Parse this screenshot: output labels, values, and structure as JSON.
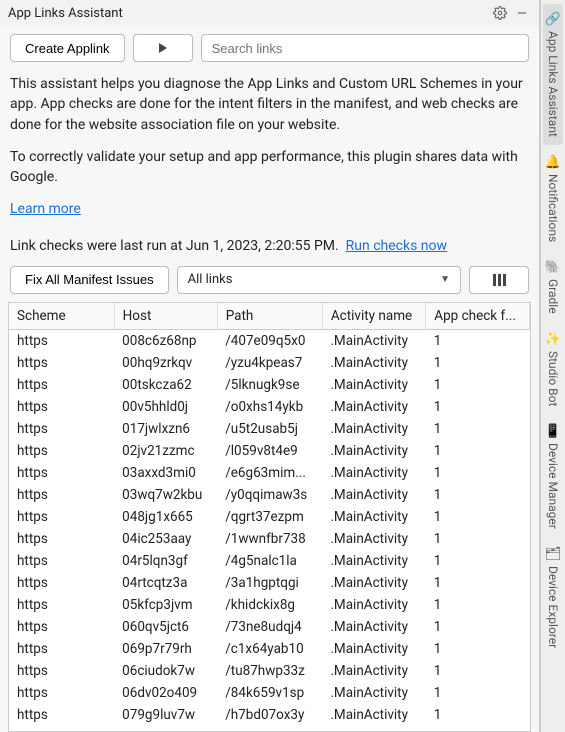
{
  "panel": {
    "title": "App Links Assistant"
  },
  "toolbar": {
    "create_label": "Create Applink",
    "search_placeholder": "Search links"
  },
  "description": {
    "p1": "This assistant helps you diagnose the App Links and Custom URL Schemes in your app. App checks are done for the intent filters in the manifest, and web checks are done for the website association file on your website.",
    "p2": "To correctly validate your setup and app performance, this plugin shares data with Google.",
    "learn_more": "Learn more"
  },
  "status": {
    "last_run_prefix": "Link checks were last run at ",
    "last_run_time": "Jun 1, 2023, 2:20:55 PM.",
    "run_now": "Run checks now"
  },
  "controls": {
    "fix_label": "Fix All Manifest Issues",
    "filter_label": "All links"
  },
  "table": {
    "headers": {
      "scheme": "Scheme",
      "host": "Host",
      "path": "Path",
      "activity": "Activity name",
      "check": "App check f..."
    },
    "rows": [
      {
        "scheme": "https",
        "host": "008c6z68np",
        "path": "/407e09q5x0",
        "activity": ".MainActivity",
        "check": "1"
      },
      {
        "scheme": "https",
        "host": "00hq9zrkqv",
        "path": "/yzu4kpeas7",
        "activity": ".MainActivity",
        "check": "1"
      },
      {
        "scheme": "https",
        "host": "00tskcza62",
        "path": "/5lknugk9se",
        "activity": ".MainActivity",
        "check": "1"
      },
      {
        "scheme": "https",
        "host": "00v5hhld0j",
        "path": "/o0xhs14ykb",
        "activity": ".MainActivity",
        "check": "1"
      },
      {
        "scheme": "https",
        "host": "017jwlxzn6",
        "path": "/u5t2usab5j",
        "activity": ".MainActivity",
        "check": "1"
      },
      {
        "scheme": "https",
        "host": "02jv21zzmc",
        "path": "/l059v8t4e9",
        "activity": ".MainActivity",
        "check": "1"
      },
      {
        "scheme": "https",
        "host": "03axxd3mi0",
        "path": "/e6g63mim...",
        "activity": ".MainActivity",
        "check": "1"
      },
      {
        "scheme": "https",
        "host": "03wq7w2kbu",
        "path": "/y0qqimaw3s",
        "activity": ".MainActivity",
        "check": "1"
      },
      {
        "scheme": "https",
        "host": "048jg1x665",
        "path": "/qgrt37ezpm",
        "activity": ".MainActivity",
        "check": "1"
      },
      {
        "scheme": "https",
        "host": "04ic253aay",
        "path": "/1wwnfbr738",
        "activity": ".MainActivity",
        "check": "1"
      },
      {
        "scheme": "https",
        "host": "04r5lqn3gf",
        "path": "/4g5nalc1la",
        "activity": ".MainActivity",
        "check": "1"
      },
      {
        "scheme": "https",
        "host": "04rtcqtz3a",
        "path": "/3a1hgptqgi",
        "activity": ".MainActivity",
        "check": "1"
      },
      {
        "scheme": "https",
        "host": "05kfcp3jvm",
        "path": "/khidckix8g",
        "activity": ".MainActivity",
        "check": "1"
      },
      {
        "scheme": "https",
        "host": "060qv5jct6",
        "path": "/73ne8udqj4",
        "activity": ".MainActivity",
        "check": "1"
      },
      {
        "scheme": "https",
        "host": "069p7r79rh",
        "path": "/c1x64yab10",
        "activity": ".MainActivity",
        "check": "1"
      },
      {
        "scheme": "https",
        "host": "06ciudok7w",
        "path": "/tu87hwp33z",
        "activity": ".MainActivity",
        "check": "1"
      },
      {
        "scheme": "https",
        "host": "06dv02o409",
        "path": "/84k659v1sp",
        "activity": ".MainActivity",
        "check": "1"
      },
      {
        "scheme": "https",
        "host": "079g9luv7w",
        "path": "/h7bd07ox3y",
        "activity": ".MainActivity",
        "check": "1"
      }
    ]
  },
  "rail": {
    "items": [
      {
        "label": "App Links Assistant",
        "icon": "🔗"
      },
      {
        "label": "Notifications",
        "icon": "🔔"
      },
      {
        "label": "Gradle",
        "icon": "🐘"
      },
      {
        "label": "Studio Bot",
        "icon": "✨"
      },
      {
        "label": "Device Manager",
        "icon": "📱"
      },
      {
        "label": "Device Explorer",
        "icon": "🗂"
      }
    ]
  }
}
